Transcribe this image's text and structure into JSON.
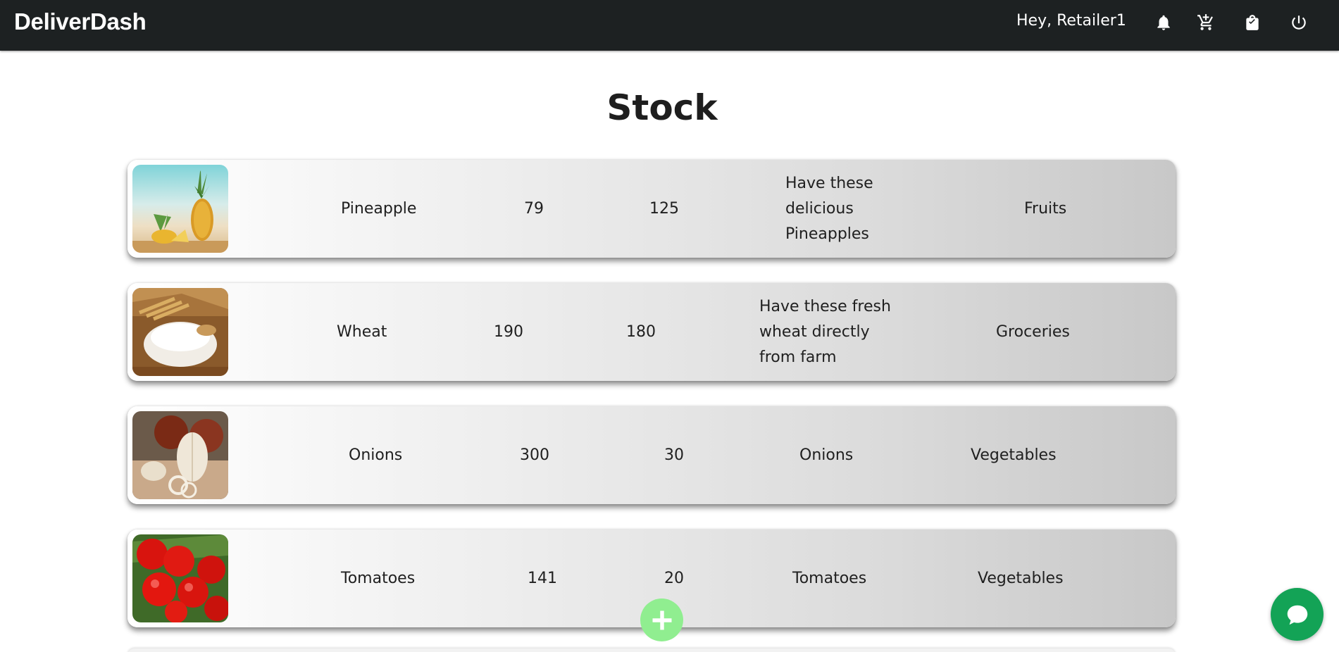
{
  "app": {
    "brand": "DeliverDash",
    "greeting": "Hey, Retailer1"
  },
  "nav_icons": [
    "bell-icon",
    "cart-icon",
    "shopping-bag-icon",
    "power-icon"
  ],
  "page": {
    "title": "Stock"
  },
  "stock": [
    {
      "name": "Pineapple",
      "price": "79",
      "quantity": "125",
      "description": [
        "Have these",
        "delicious",
        "Pineapples"
      ],
      "category": "Fruits",
      "image": "pineapple"
    },
    {
      "name": "Wheat",
      "price": "190",
      "quantity": "180",
      "description": [
        "Have these fresh",
        "wheat directly",
        "from farm"
      ],
      "category": "Groceries",
      "image": "wheat"
    },
    {
      "name": "Onions",
      "price": "300",
      "quantity": "30",
      "description": [
        "Onions"
      ],
      "category": "Vegetables",
      "image": "onions"
    },
    {
      "name": "Tomatoes",
      "price": "141",
      "quantity": "20",
      "description": [
        "Tomatoes"
      ],
      "category": "Vegetables",
      "image": "tomatoes"
    }
  ],
  "colors": {
    "navbar": "#1d2122",
    "add_button": "#90ee90",
    "chat_button": "#13a356"
  },
  "fab": {
    "add_icon": "plus-icon",
    "chat_icon": "chat-bubble-icon"
  }
}
